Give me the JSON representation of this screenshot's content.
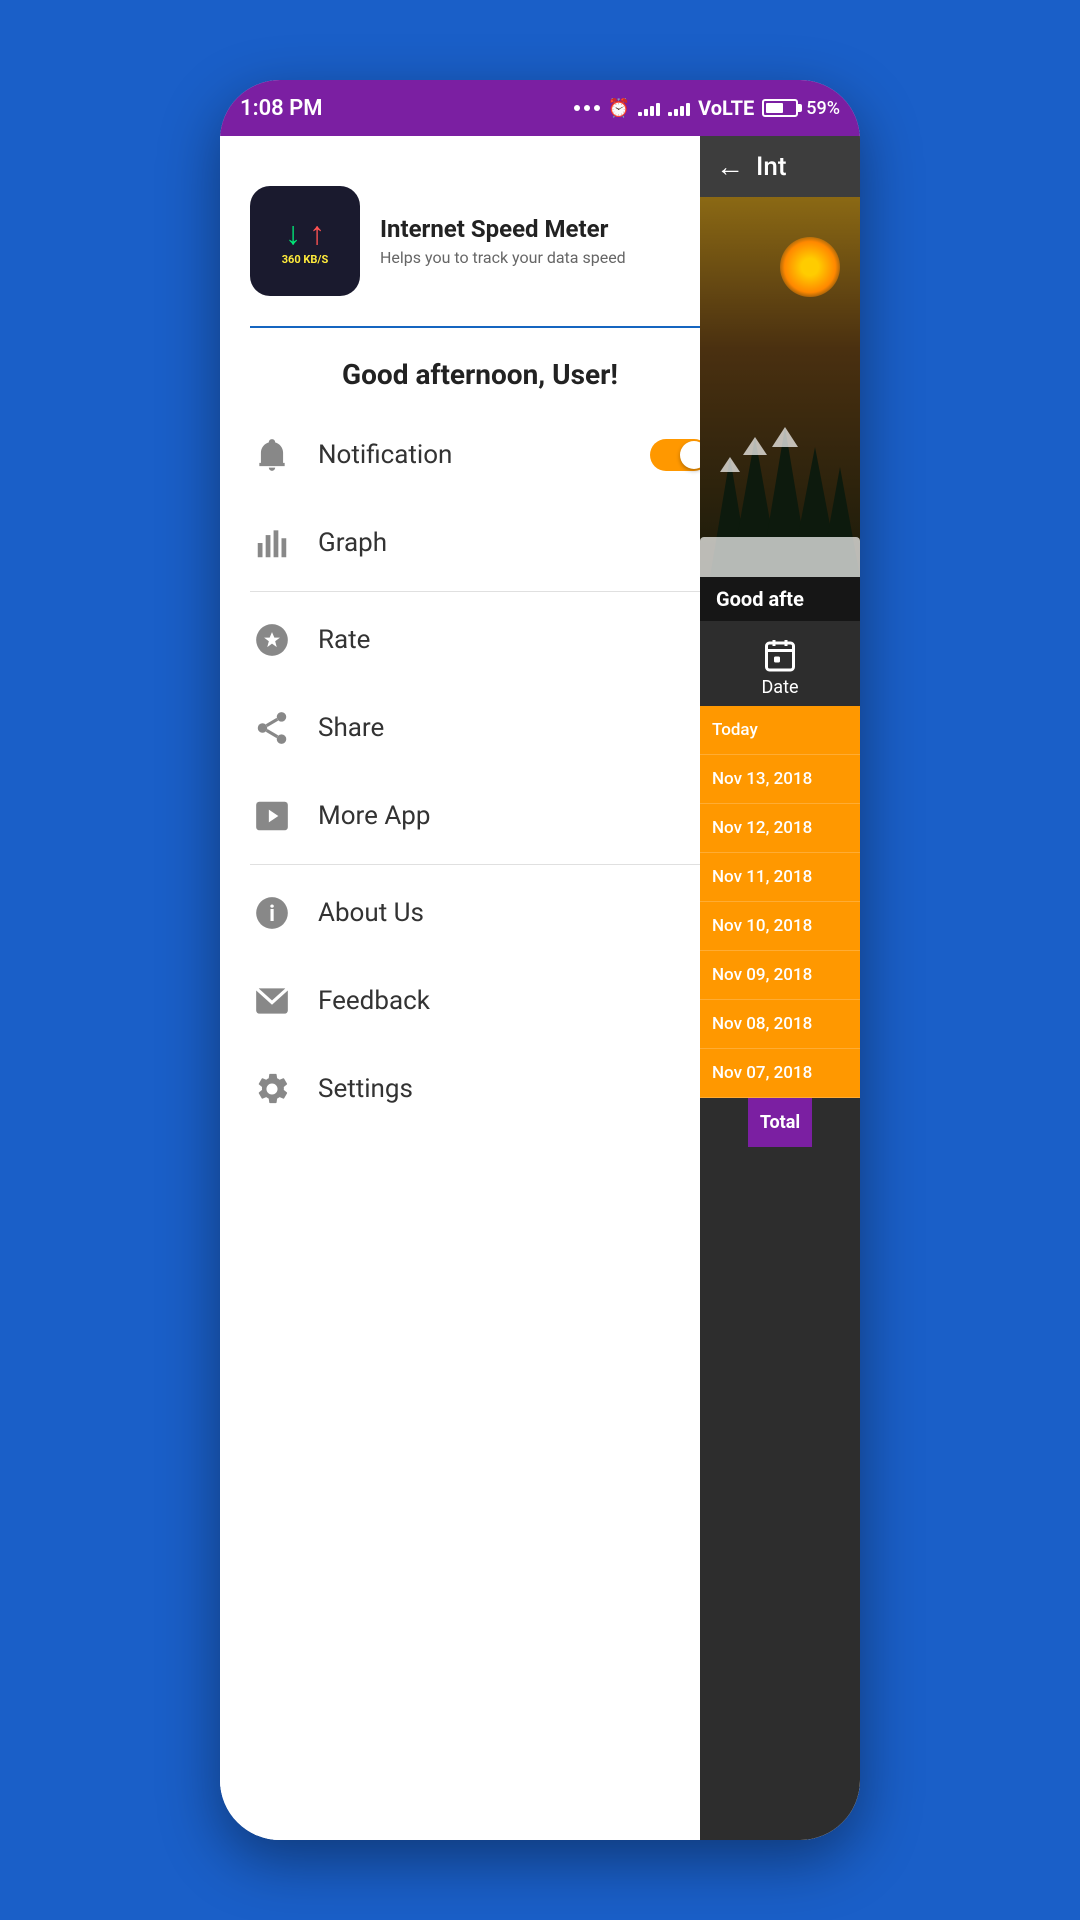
{
  "status_bar": {
    "time": "1:08 PM",
    "battery_percent": "59%",
    "network": "VoLTE"
  },
  "app_header": {
    "app_name": "Internet Speed Meter",
    "app_desc": "Helps you to track your data speed",
    "speed_label": "360 KB/S"
  },
  "greeting": "Good afternoon, User!",
  "menu_items": [
    {
      "id": "notification",
      "label": "Notification",
      "icon": "bell",
      "has_toggle": true,
      "toggle_on": true
    },
    {
      "id": "graph",
      "label": "Graph",
      "icon": "graph",
      "has_toggle": false
    },
    {
      "id": "rate",
      "label": "Rate",
      "icon": "star",
      "has_toggle": false
    },
    {
      "id": "share",
      "label": "Share",
      "icon": "share",
      "has_toggle": false
    },
    {
      "id": "more-app",
      "label": "More App",
      "icon": "play",
      "has_toggle": false
    },
    {
      "id": "about-us",
      "label": "About Us",
      "icon": "info",
      "has_toggle": false
    },
    {
      "id": "feedback",
      "label": "Feedback",
      "icon": "mail",
      "has_toggle": false
    },
    {
      "id": "settings",
      "label": "Settings",
      "icon": "gear",
      "has_toggle": false
    }
  ],
  "right_panel": {
    "title": "Int",
    "greeting_partial": "Good afte",
    "date_label": "Date",
    "date_items": [
      "Today",
      "Nov 13, 2018",
      "Nov 12, 2018",
      "Nov 11, 2018",
      "Nov 10, 2018",
      "Nov 09, 2018",
      "Nov 08, 2018",
      "Nov 07, 2018"
    ],
    "total_label": "Total"
  },
  "sections": {
    "divider1_after": "graph",
    "divider2_after": "more-app"
  }
}
